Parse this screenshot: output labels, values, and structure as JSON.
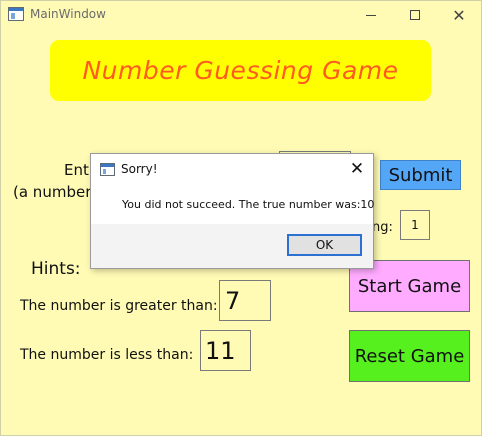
{
  "window": {
    "title": "MainWindow",
    "icon": "app-window-icon"
  },
  "titlebar": {
    "close_glyph": "✕"
  },
  "banner": {
    "title": "Number Guessing Game"
  },
  "form": {
    "enter_label_fragment": "Ent",
    "range_label_fragment": "(a number",
    "submit_label": "Submit",
    "remaining_label_fragment": "ng:",
    "remaining_value": "1"
  },
  "hints": {
    "heading": "Hints:",
    "greater_label": "The number is greater than:",
    "greater_value": "7",
    "less_label": "The number is less than:",
    "less_value": "11"
  },
  "buttons": {
    "start": "Start Game",
    "reset": "Reset Game"
  },
  "dialog": {
    "title": "Sorry!",
    "message": "You did not succeed. The true number was:10",
    "ok_label": "OK",
    "close_glyph": "✕"
  },
  "colors": {
    "window_bg": "#fffbb5",
    "banner_bg": "#ffff00",
    "banner_text": "#ff5a1f",
    "submit_bg": "#54a6f6",
    "start_bg": "#ffabff",
    "reset_bg": "#55f01e"
  }
}
